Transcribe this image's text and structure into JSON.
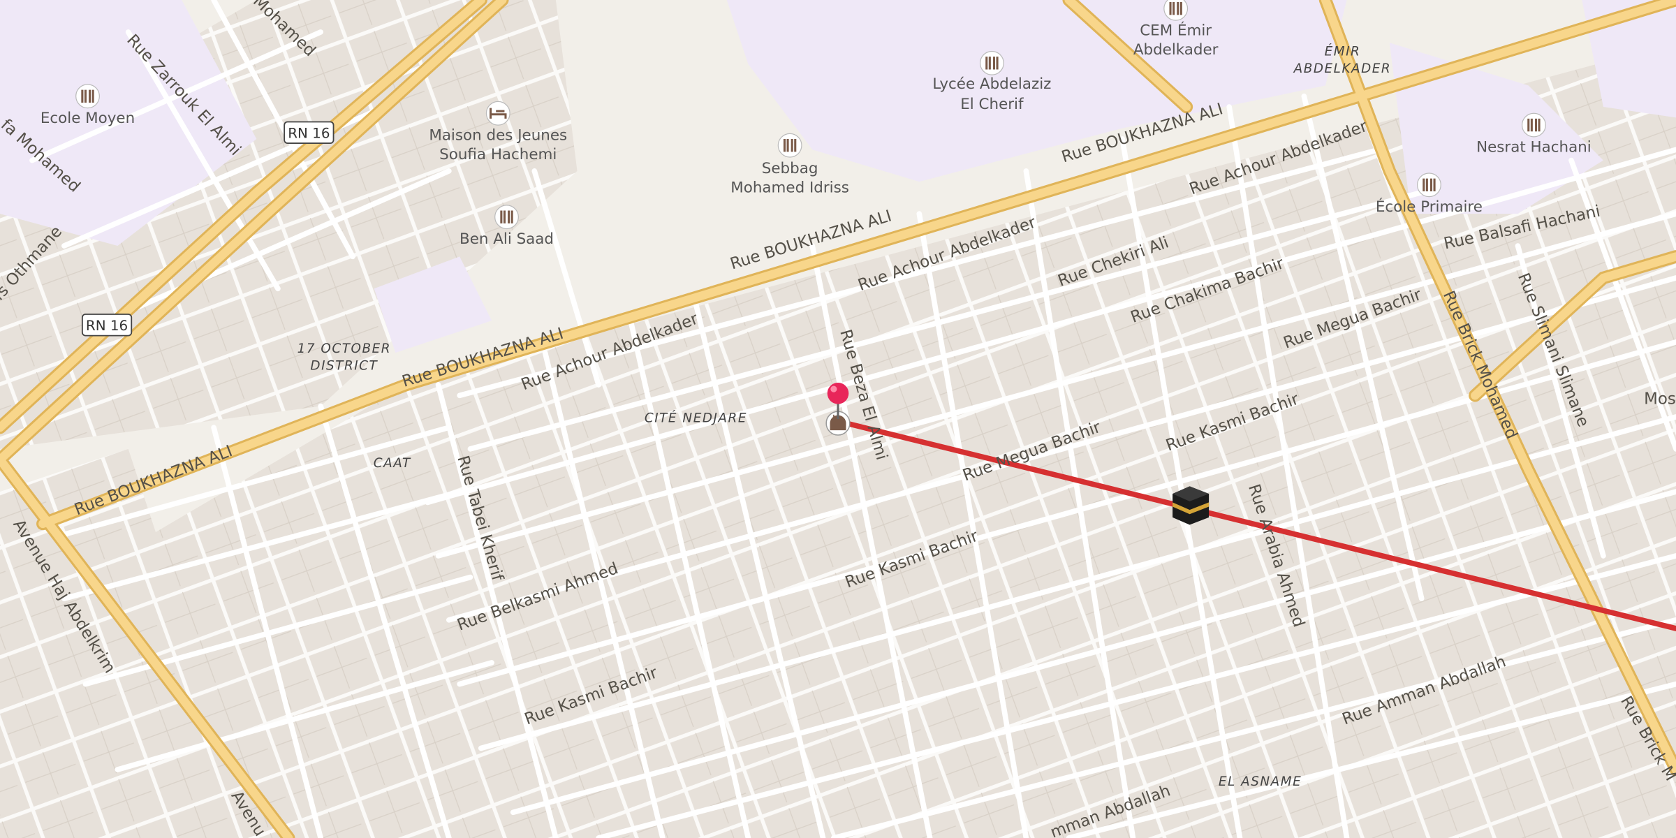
{
  "map": {
    "colors": {
      "land": "#f2efe9",
      "block": "#e7e1da",
      "block_stroke": "#d6cec5",
      "school_area": "#efe8f7",
      "minor_road": "#ffffff",
      "major_road": "#f8d68b",
      "major_road_casing": "#e0b458",
      "route_line": "#d63031",
      "pin": "#e8265a"
    },
    "shields": [
      {
        "text": "RN 16"
      },
      {
        "text": "RN 16"
      }
    ],
    "streets": [
      "Rue BOUKHAZNA ALI",
      "Rue BOUKHAZNA ALI",
      "Rue BOUKHAZNA ALI",
      "Rue BOUKHAZNA ALI",
      "Rue Achour Abdelkader",
      "Rue Achour Abdelkader",
      "Rue Achour Abdelkader",
      "Rue Chekiri Ali",
      "Rue Chakima Bachir",
      "Rue Megua Bachir",
      "Rue Megua Bachir",
      "Rue Kasmi Bachir",
      "Rue Kasmi Bachir",
      "Rue Kasmi Bachir",
      "Rue Belkasmi Ahmed",
      "Rue Beza El Almi",
      "Rue Tabei Kherif",
      "Rue Arabia Ahmed",
      "Rue Brick Mohamed",
      "Rue Brick M",
      "Rue Slimani Slimane",
      "Rue Balsafi Hachani",
      "Rue Amman Abdallah",
      "mman Abdallah",
      "Rue Zarrouk El Almi",
      "Mohamed",
      "fa Mohamed",
      "fs Othmane",
      "Avenue Haj Abdelkrim",
      "Avenu",
      "Mos"
    ],
    "districts": [
      "17 OCTOBER",
      "DISTRICT",
      "CITÉ NEDJARE",
      "CAAT",
      "ÉMIR",
      "ABDELKADER",
      "EL ASNAME"
    ],
    "pois": [
      {
        "icon": "school-icon",
        "lines": [
          "Ecole Moyen"
        ]
      },
      {
        "icon": "lodging-icon",
        "lines": [
          "Maison des Jeunes",
          "Soufia Hachemi"
        ]
      },
      {
        "icon": "school-icon",
        "lines": [
          "Sebbag",
          "Mohamed Idriss"
        ]
      },
      {
        "icon": "school-icon",
        "lines": [
          "Ben Ali Saad"
        ]
      },
      {
        "icon": "school-icon",
        "lines": [
          "Lycée Abdelaziz",
          "El Cherif"
        ]
      },
      {
        "icon": "school-icon",
        "lines": [
          "CEM Émir",
          "Abdelkader"
        ]
      },
      {
        "icon": "school-icon",
        "lines": [
          "Nesrat Hachani"
        ]
      },
      {
        "icon": "school-icon",
        "lines": [
          "École Primaire"
        ]
      }
    ],
    "markers": {
      "pin_icon": "location-pin-icon",
      "origin_icon": "mosque-icon",
      "destination_icon": "kaaba-icon"
    }
  }
}
